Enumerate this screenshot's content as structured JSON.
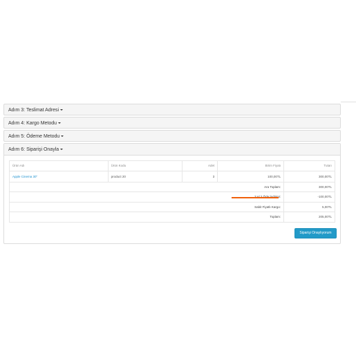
{
  "steps": {
    "step3": "Adım 3: Teslimat Adresi",
    "step4": "Adım 4: Kargo Metodu",
    "step5": "Adım 5: Ödeme Metodu",
    "step6": "Adım 6: Siparişi Onayla"
  },
  "table": {
    "headers": {
      "name": "Ürün Adı",
      "code": "Ürün Kodu",
      "qty": "Adet",
      "unit_price": "Birim Fiyatı",
      "total": "Tutarı"
    },
    "row": {
      "name": "Apple Cinema 30\"",
      "code": "product 20",
      "qty": "3",
      "unit_price": "100,00TL",
      "total": "300,00TL"
    },
    "totals": {
      "subtotal_label": "Ara Toplam:",
      "subtotal_value": "300,00TL",
      "discount_label": "3 Al 2 Öde İndirimi:",
      "discount_value": "-100,00TL",
      "shipping_label": "Sabit Fiyatlı Kargo:",
      "shipping_value": "5,00TL",
      "total_label": "Toplam:",
      "total_value": "205,00TL"
    }
  },
  "confirm_button": "Siparişi Onaylıyorum",
  "colors": {
    "accent": "#229ac8",
    "link": "#1e91cf",
    "highlight": "#f0600a"
  }
}
